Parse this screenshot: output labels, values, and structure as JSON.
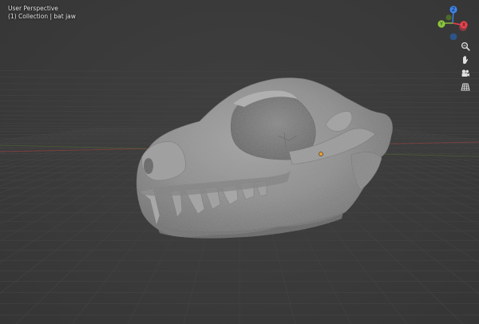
{
  "viewport": {
    "view_name": "User Perspective",
    "collection_label": "(1) Collection | bat jaw",
    "object_name": "bat jaw"
  },
  "gizmo": {
    "axes": [
      {
        "name": "X",
        "color": "#e8434f"
      },
      {
        "name": "Y",
        "color": "#8cc63e"
      },
      {
        "name": "Z",
        "color": "#3e83e8"
      }
    ]
  },
  "navigation_icons": [
    "zoom-icon",
    "hand-pan-icon",
    "camera-icon",
    "orthographic-grid-icon"
  ],
  "colors": {
    "background": "#3a3a3a",
    "grid": "#454545",
    "x_axis_line": "#7a4040",
    "y_axis_line": "#5a7a30",
    "mesh": "#8f8f8f",
    "origin": "#f0a030"
  }
}
